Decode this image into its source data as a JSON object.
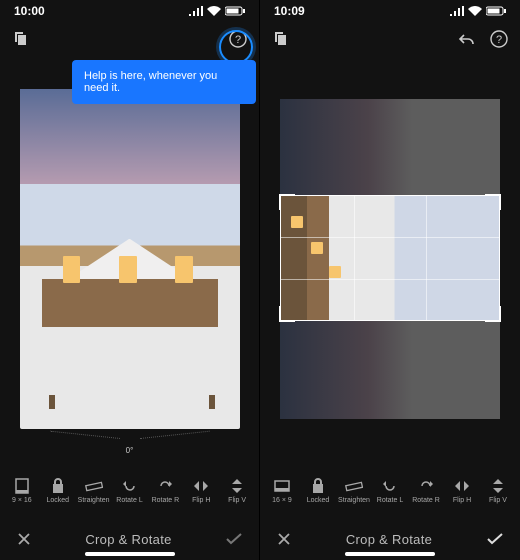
{
  "left": {
    "status_time": "10:00",
    "tooltip_text": "Help is here, whenever you need it.",
    "dial_value": "0°",
    "tools": {
      "aspect": "9 × 16",
      "lock": "Locked",
      "straighten": "Straighten",
      "rotate_l": "Rotate L",
      "rotate_r": "Rotate R",
      "flip_h": "Flip H",
      "flip_v": "Flip V"
    },
    "mode_title": "Crop & Rotate"
  },
  "right": {
    "status_time": "10:09",
    "tools": {
      "aspect": "16 × 9",
      "lock": "Locked",
      "straighten": "Straighten",
      "rotate_l": "Rotate L",
      "rotate_r": "Rotate R",
      "flip_h": "Flip H",
      "flip_v": "Flip V"
    },
    "mode_title": "Crop & Rotate"
  }
}
